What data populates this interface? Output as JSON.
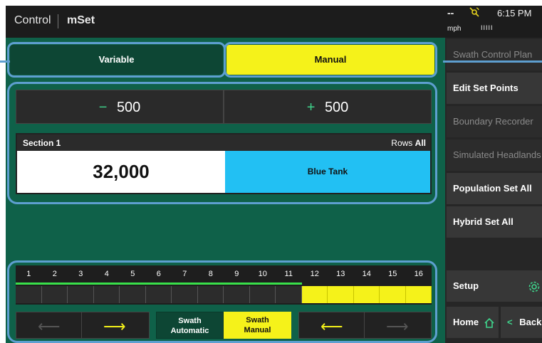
{
  "header": {
    "title_prefix": "Control",
    "title": "mSet",
    "speed_value": "--",
    "speed_unit": "mph",
    "signal_bars": "IIIII",
    "time": "6:15 PM"
  },
  "mode_tabs": {
    "variable": "Variable",
    "manual": "Manual"
  },
  "rate_adjust": {
    "decrease_sign": "−",
    "decrease_value": "500",
    "increase_sign": "+",
    "increase_value": "500"
  },
  "section": {
    "name": "Section 1",
    "rows_label": "Rows",
    "rows_value": "All",
    "rate": "32,000",
    "product": "Blue Tank"
  },
  "sections_bar": {
    "numbers": [
      "1",
      "2",
      "3",
      "4",
      "5",
      "6",
      "7",
      "8",
      "9",
      "10",
      "11",
      "12",
      "13",
      "14",
      "15",
      "16"
    ],
    "active_green_count": 11,
    "yellow_start": 12
  },
  "swath_controls": {
    "left_arrow": "⟵",
    "right_arrow": "⟶",
    "automatic_line1": "Swath",
    "automatic_line2": "Automatic",
    "manual_line1": "Swath",
    "manual_line2": "Manual",
    "left_arrow_yellow": "⟵",
    "right_arrow_dim": "⟶"
  },
  "sidebar": {
    "items": [
      {
        "label": "Swath Control Plan",
        "enabled": false
      },
      {
        "label": "Edit Set Points",
        "enabled": true
      },
      {
        "label": "Boundary Recorder",
        "enabled": false
      },
      {
        "label": "Simulated Headlands",
        "enabled": false
      },
      {
        "label": "Population Set All",
        "enabled": true
      },
      {
        "label": "Hybrid Set All",
        "enabled": true
      }
    ],
    "setup": "Setup",
    "home": "Home",
    "back": "Back"
  },
  "colors": {
    "accent_green": "#0f6149",
    "highlight_yellow": "#f5f21a",
    "tank_blue": "#22c0f3",
    "outline_blue": "#5e9fd0",
    "active_section_green": "#39e04a"
  }
}
